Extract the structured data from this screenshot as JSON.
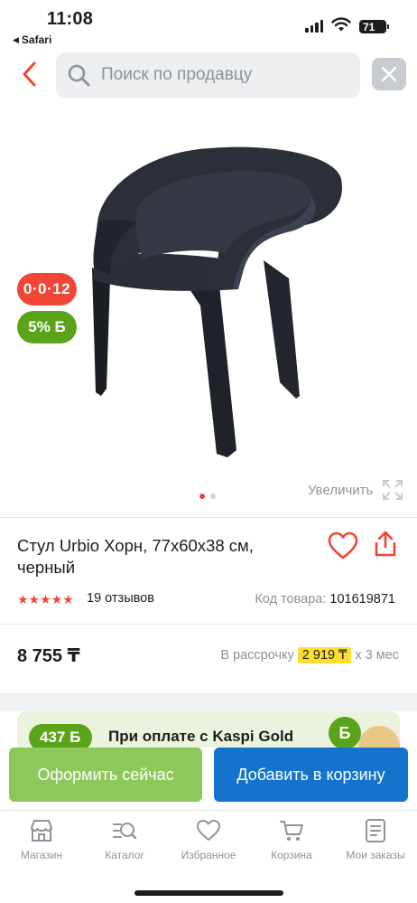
{
  "status_bar": {
    "time": "11:08",
    "back_app": "Safari",
    "battery": "71"
  },
  "header": {
    "search_placeholder": "Поиск по продавцу"
  },
  "gallery": {
    "badge_installment": "0·0·12",
    "badge_bonus": "5% Б",
    "zoom_label": "Увеличить",
    "page_count": 2,
    "current_page": 1
  },
  "product": {
    "title": "Стул Urbio Хорн, 77x60x38 см, черный",
    "rating_stars": "★★★★★",
    "rating": 5,
    "reviews": "19 отзывов",
    "code_label": "Код товара:",
    "code_value": "101619871",
    "price": "8 755 ₸",
    "installment_prefix": "В рассрочку",
    "installment_amount": "2 919 ₸",
    "installment_suffix": "x 3 мес"
  },
  "promo": {
    "bonus": "437 Б",
    "text": "При оплате с Kaspi Gold",
    "coin_symbol": "Б"
  },
  "actions": {
    "buy_now": "Оформить сейчас",
    "add_to_cart": "Добавить в корзину"
  },
  "tabbar": {
    "items": [
      {
        "label": "Магазин",
        "icon": "store-icon"
      },
      {
        "label": "Каталог",
        "icon": "catalog-search-icon"
      },
      {
        "label": "Избранное",
        "icon": "heart-icon"
      },
      {
        "label": "Корзина",
        "icon": "cart-icon"
      },
      {
        "label": "Мои заказы",
        "icon": "orders-icon"
      }
    ]
  },
  "colors": {
    "accent_red": "#f14635",
    "bonus_green": "#5aa31a",
    "buy_button": "#8dc85b",
    "cart_button": "#1473cc",
    "installment_highlight": "#ffdd2d"
  }
}
